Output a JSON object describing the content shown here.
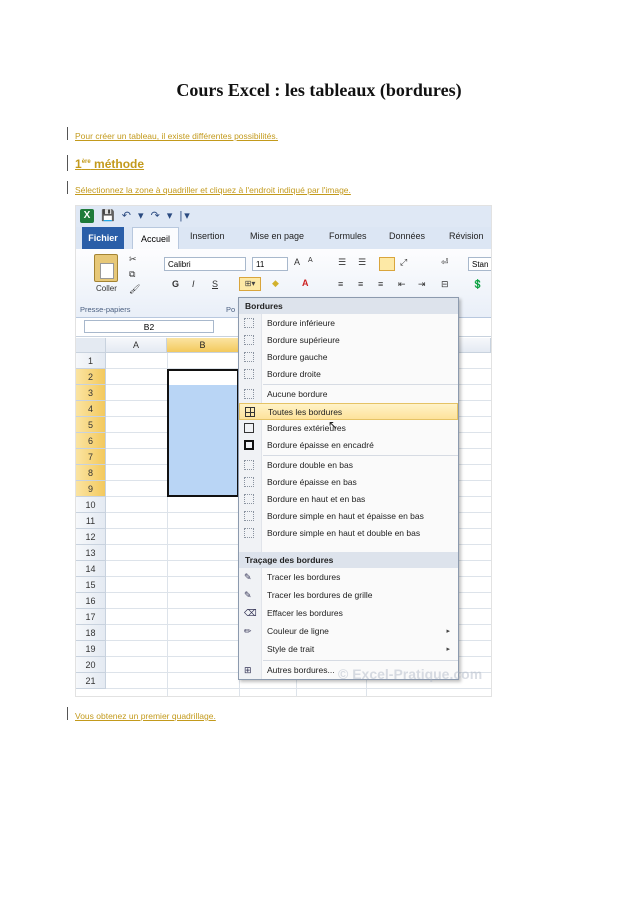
{
  "document": {
    "title": "Cours Excel : les tableaux (bordures)",
    "intro": "Pour créer un tableau, il existe différentes possibilités.",
    "method_heading": "1",
    "method_heading_sup": "ère",
    "method_heading_rest": " méthode",
    "instruction": "Sélectionnez la zone à quadriller et cliquez à l'endroit indiqué par l'image.",
    "result": "Vous obtenez un premier quadrillage."
  },
  "excel": {
    "quick_access_icons": "💾 ↶ ▾ ↷ ▾ |▾",
    "tabs": [
      "Fichier",
      "Accueil",
      "Insertion",
      "Mise en page",
      "Formules",
      "Données",
      "Révision"
    ],
    "ribbon": {
      "paste_label": "Coller",
      "clipboard_group": "Presse-papiers",
      "font_group_partial": "Po",
      "font_name": "Calibri",
      "font_size": "11",
      "style_box": "Stan",
      "bold": "G",
      "italic": "I",
      "underline": "S"
    },
    "name_box": "B2",
    "columns": [
      "A",
      "B"
    ],
    "rows": [
      "1",
      "2",
      "3",
      "4",
      "5",
      "6",
      "7",
      "8",
      "9",
      "10",
      "11",
      "12",
      "13",
      "14",
      "15",
      "16",
      "17",
      "18",
      "19",
      "20",
      "21"
    ],
    "menu": {
      "header_borders": "Bordures",
      "items_borders": [
        "Bordure inférieure",
        "Bordure supérieure",
        "Bordure gauche",
        "Bordure droite",
        "Aucune bordure",
        "Toutes les bordures",
        "Bordures extérieures",
        "Bordure épaisse en encadré",
        "Bordure double en bas",
        "Bordure épaisse en bas",
        "Bordure en haut et en bas",
        "Bordure simple en haut et épaisse en bas",
        "Bordure simple en haut et double en bas"
      ],
      "header_drawing": "Traçage des bordures",
      "items_drawing": [
        "Tracer les bordures",
        "Tracer les bordures de grille",
        "Effacer les bordures",
        "Couleur de ligne",
        "Style de trait",
        "Autres bordures..."
      ]
    },
    "watermark": "© Excel-Pratique.com"
  }
}
